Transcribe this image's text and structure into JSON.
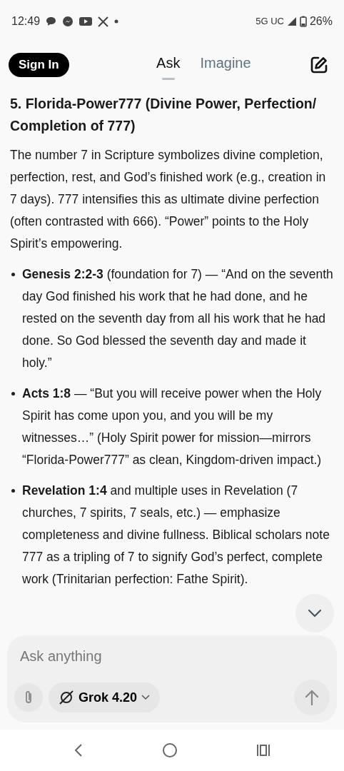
{
  "status_bar": {
    "time": "12:49",
    "network": "5G UC",
    "battery": "26%"
  },
  "header": {
    "sign_in": "Sign In",
    "tabs": [
      {
        "label": "Ask",
        "selected": true
      },
      {
        "label": "Imagine",
        "selected": false
      }
    ]
  },
  "heading": "5. Florida-Power777 (Divine Power, Perfection/ Completion of 777)",
  "paragraph": "The number 7 in Scripture symbolizes divine completion, perfection, rest, and God’s finished work (e.g., creation in 7 days). 777 intensifies this as ultimate divine perfection (often contrasted with 666). “Power” points to the Holy Spirit’s empowering.",
  "bullets": [
    {
      "text": "**Genesis 2:2-3** (foundation for 7) — “And on the seventh day God finished his work that he had done, and he rested on the seventh day from all his work that he had done. So God blessed the seventh day and made it holy.”"
    },
    {
      "text": "**Acts 1:8** — “But you will receive power when the Holy Spirit has come upon you, and you will be my witnesses…” (Holy Spirit power for mission—mirrors “Florida-Power777” as clean, Kingdom-driven impact.)"
    },
    {
      "text": "**Revelation 1:4** and multiple uses in Revelation (7 churches, 7 spirits, 7 seals, etc.) — emphasize completeness and divine fullness. Biblical scholars note 777 as a tripling of 7 to signify God’s perfect, complete work (Trinitarian perfection: Fathe Spirit)."
    }
  ],
  "composer": {
    "placeholder": "Ask anything",
    "model": "Grok 4.20"
  }
}
